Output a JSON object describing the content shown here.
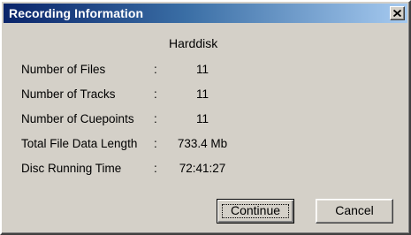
{
  "window": {
    "title": "Recording Information"
  },
  "column_header": "Harddisk",
  "rows": [
    {
      "label": "Number of Files",
      "separator": ":",
      "value": "11"
    },
    {
      "label": "Number of Tracks",
      "separator": ":",
      "value": "11"
    },
    {
      "label": "Number of Cuepoints",
      "separator": ":",
      "value": "11"
    },
    {
      "label": "Total File Data Length",
      "separator": ":",
      "value": "733.4 Mb"
    },
    {
      "label": "Disc Running Time",
      "separator": ":",
      "value": "72:41:27"
    }
  ],
  "buttons": {
    "continue_label": "Continue",
    "cancel_label": "Cancel"
  },
  "icons": {
    "close": "close-icon"
  },
  "colors": {
    "titlebar_start": "#0a246a",
    "titlebar_end": "#a6caf0",
    "dialog_face": "#d4d0c8"
  }
}
